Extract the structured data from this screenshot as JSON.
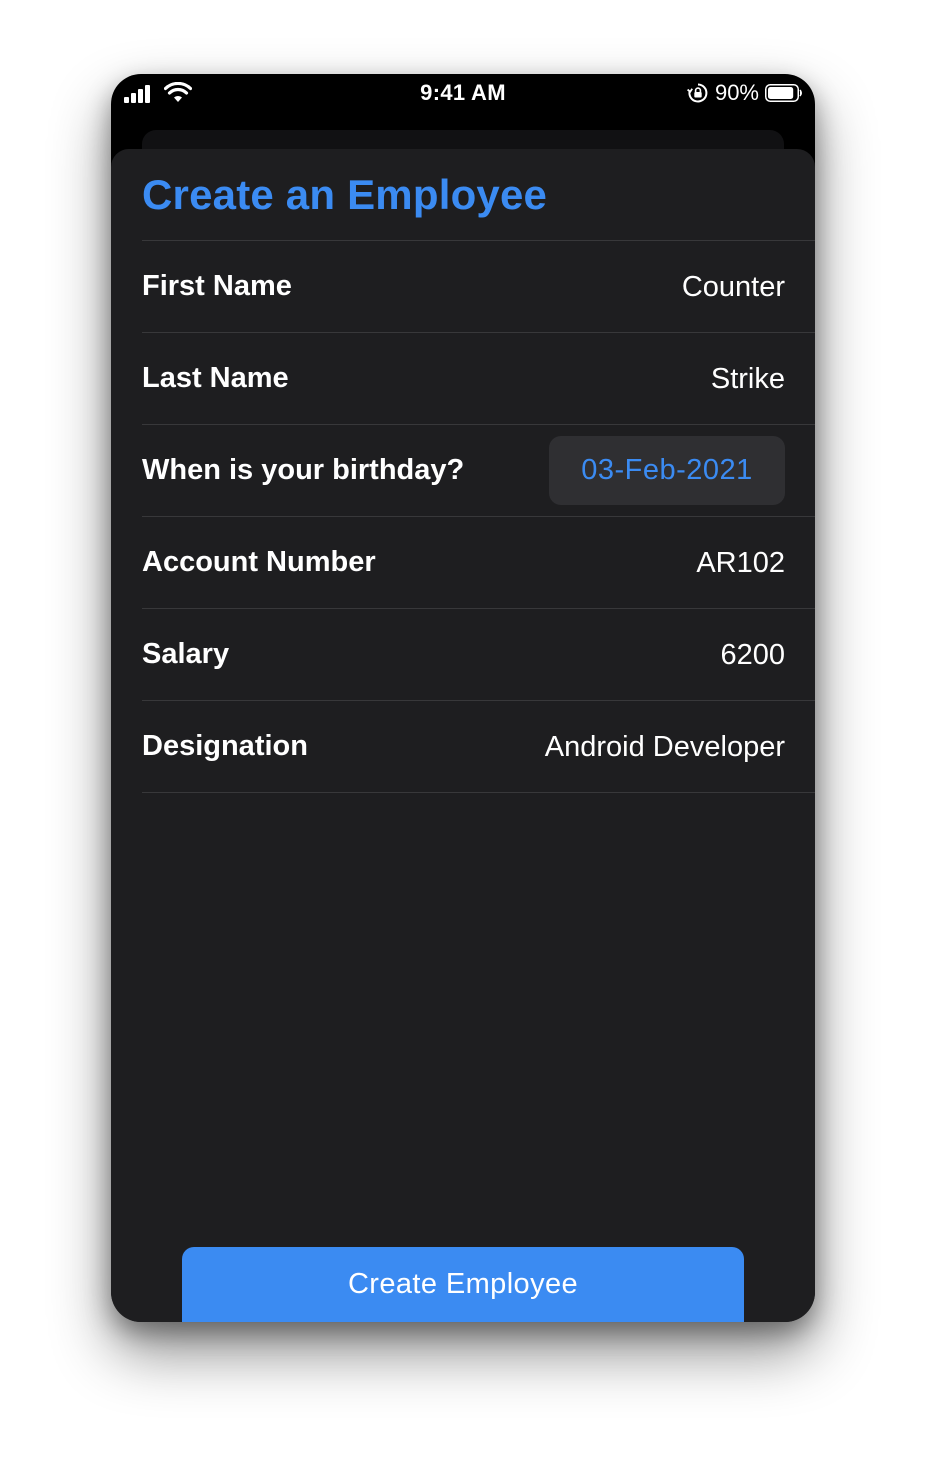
{
  "status_bar": {
    "time": "9:41 AM",
    "battery_percent": "90%",
    "battery_level": 0.9,
    "icons": [
      "signal-icon",
      "wifi-icon",
      "orientation-lock-icon",
      "battery-icon"
    ]
  },
  "form": {
    "title": "Create an Employee",
    "fields": [
      {
        "label": "First Name",
        "value": "Counter"
      },
      {
        "label": "Last Name",
        "value": "Strike"
      },
      {
        "label": "When is your birthday?",
        "value": "03-Feb-2021"
      },
      {
        "label": "Account Number",
        "value": "AR102"
      },
      {
        "label": "Salary",
        "value": "6200"
      },
      {
        "label": "Designation",
        "value": "Android Developer"
      }
    ],
    "submit_label": "Create Employee"
  },
  "colors": {
    "accent": "#3b8bf2",
    "sheet_background": "#1e1e20",
    "separator": "#38383a"
  }
}
